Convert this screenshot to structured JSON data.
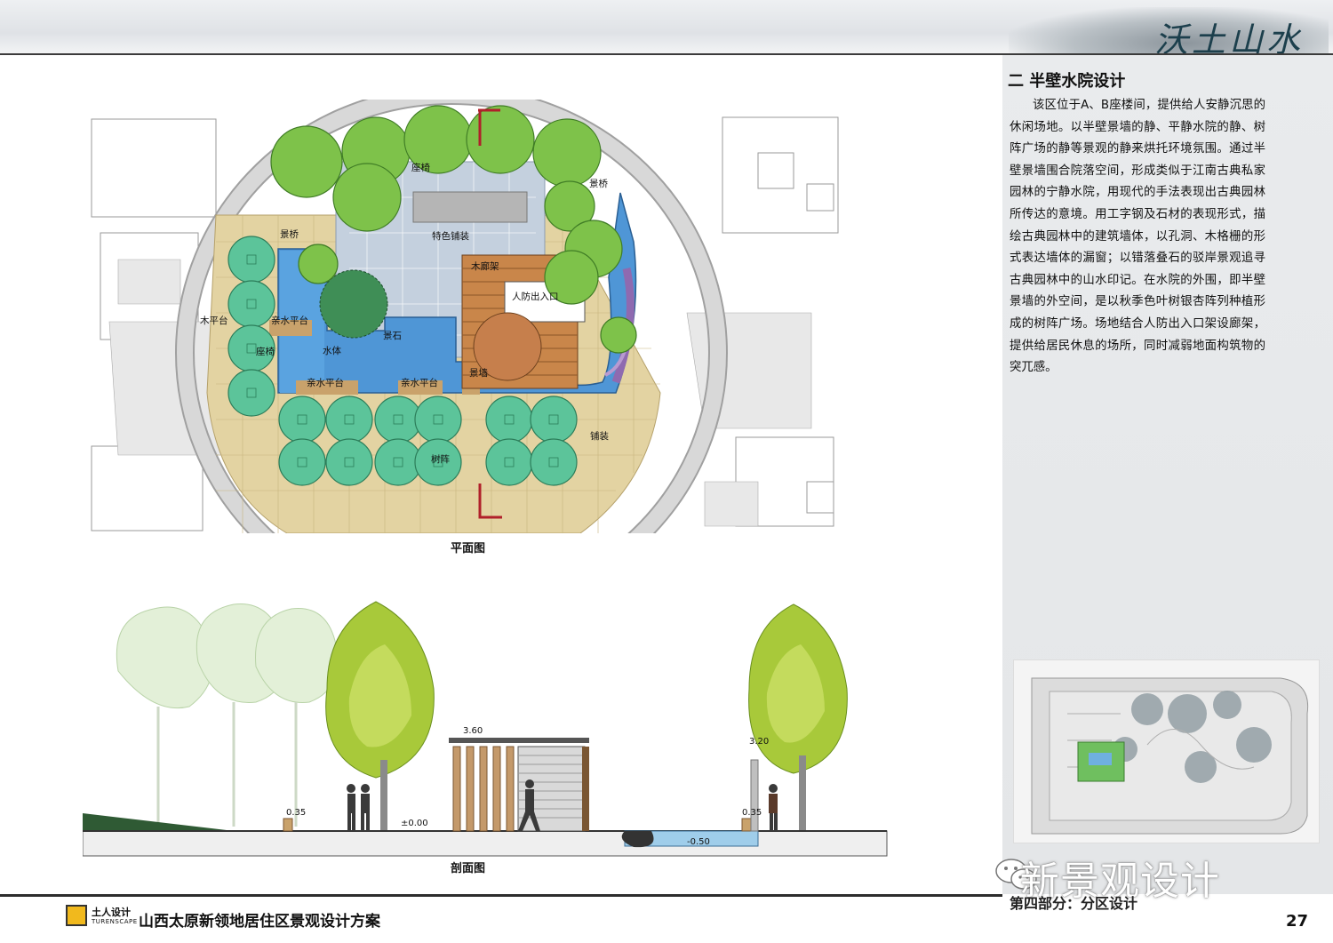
{
  "header": {
    "brush_title": "沃土山水"
  },
  "section": {
    "title": "二 半壁水院设计",
    "body": "该区位于A、B座楼间，提供给人安静沉思的休闲场地。以半壁景墙的静、平静水院的静、树阵广场的静等景观的静来烘托环境氛围。通过半壁景墙围合院落空间，形成类似于江南古典私家园林的宁静水院，用现代的手法表现出古典园林所传达的意境。用工字钢及石材的表现形式，描绘古典园林中的建筑墙体，以孔洞、木格栅的形式表达墙体的漏窗；以错落叠石的驳岸景观追寻古典园林中的山水印记。在水院的外围，即半壁景墙的外空间，是以秋季色叶树银杏阵列种植形成的树阵广场。场地结合人防出入口架设廊架，提供给居民休息的场所，同时减弱地面构筑物的突兀感。"
  },
  "plan": {
    "caption": "平面图",
    "labels": {
      "seat_top": "座椅",
      "bridge_right": "景桥",
      "bridge_left": "景桥",
      "feature_paving": "特色铺装",
      "pergola": "木廊架",
      "civil_defense": "人防出入口",
      "wood_platform": "木平台",
      "water_platform_left": "亲水平台",
      "rock": "景石",
      "water": "水体",
      "seat_left": "座椅",
      "water_platform_b1": "亲水平台",
      "water_platform_b2": "亲水平台",
      "bridge_bottom": "景墙",
      "paving": "铺装",
      "tree_array": "树阵"
    }
  },
  "elevation": {
    "caption": "剖面图",
    "labels": {
      "e360": "3.60",
      "e320": "3.20",
      "e035_left": "0.35",
      "e000": "±0.00",
      "e035_right": "0.35",
      "e050": "-0.50"
    }
  },
  "side": {
    "watermark": "新景观设计",
    "part_label": "第四部分：分区设计"
  },
  "footer": {
    "logo_cn": "土人设计",
    "logo_en": "TURENSCAPE",
    "project_title": "山西太原新领地居住区景观设计方案",
    "page_number": "27"
  },
  "colors": {
    "tree_green": "#7ec24a",
    "ginkgo_teal": "#5cc49a",
    "water_blue": "#4f96d6",
    "paving_tan": "#e0cf9c",
    "pergola_brown": "#c9864a"
  }
}
